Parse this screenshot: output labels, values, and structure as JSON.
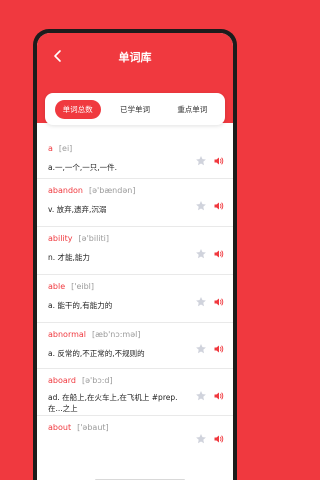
{
  "title": "单词库",
  "tabs": [
    {
      "label": "单词总数"
    },
    {
      "label": "已学单词"
    },
    {
      "label": "重点单词"
    }
  ],
  "words": [
    {
      "word": "a",
      "phonetic": "[ei]",
      "meaning": "a.一,一个,一只,一件."
    },
    {
      "word": "abandon",
      "phonetic": "[ə'bændən]",
      "meaning": "v. 放弃,遗弃,沉溺"
    },
    {
      "word": "ability",
      "phonetic": "[ə'biliti]",
      "meaning": "n. 才能,能力"
    },
    {
      "word": "able",
      "phonetic": "['eibl]",
      "meaning": "a. 能干的,有能力的"
    },
    {
      "word": "abnormal",
      "phonetic": "[æb'nɔ:məl]",
      "meaning": "a. 反常的,不正常的,不规则的"
    },
    {
      "word": "aboard",
      "phonetic": "[ə'bɔ:d]",
      "meaning": "ad. 在船上,在火车上,在飞机上 #prep. 在...之上"
    },
    {
      "word": "about",
      "phonetic": "['əbaut]",
      "meaning": ""
    }
  ],
  "colors": {
    "accent": "#f0393f",
    "star": "#d0d3dc"
  },
  "icons": {
    "back": "chevron-left-icon",
    "star": "star-icon",
    "speaker": "speaker-icon"
  }
}
